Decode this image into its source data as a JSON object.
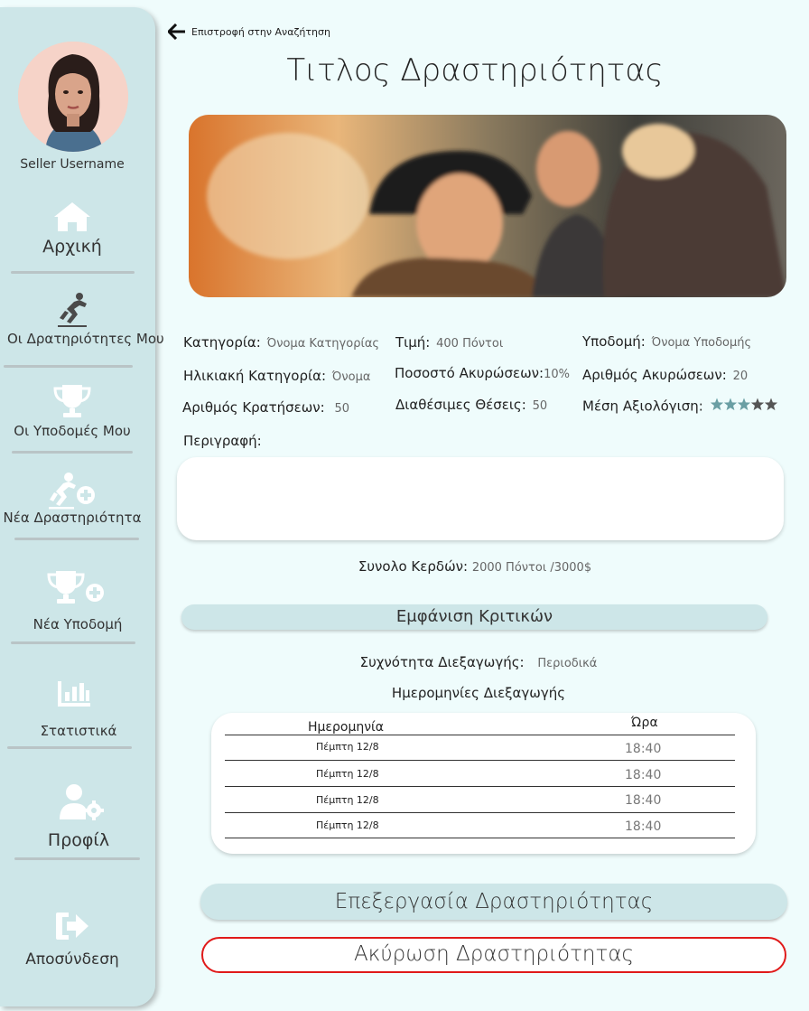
{
  "sidebar": {
    "seller_username": "Seller Username",
    "items": [
      {
        "label": "Αρχική",
        "icon": "home-icon"
      },
      {
        "label": "Οι Δρατηριότητες Μου",
        "icon": "skater-icon"
      },
      {
        "label": "Οι Υποδομές Μου",
        "icon": "trophy-icon"
      },
      {
        "label": "Νέα Δραστηριότητα",
        "icon": "skater-plus-icon"
      },
      {
        "label": "Νέα Υποδομή",
        "icon": "trophy-plus-icon"
      },
      {
        "label": "Στατιστικά",
        "icon": "bar-chart-icon"
      },
      {
        "label": "Προφίλ",
        "icon": "user-gear-icon"
      },
      {
        "label": "Αποσύνδεση",
        "icon": "logout-icon"
      }
    ]
  },
  "back_link": "Επιστροφή στην Αναζήτηση",
  "title": "Τιτλος Δραστηριότητας",
  "info": {
    "category_label": "Κατηγορία:",
    "category_value": "Όνομα Κατηγορίας",
    "price_label": "Τιμή:",
    "price_value": "400 Πόντοι",
    "facility_label": "Υποδομή:",
    "facility_value": "Όνομα Υποδομής",
    "age_label": "Ηλικιακή Κατηγορία:",
    "age_value": "Όνομα",
    "cancel_rate_label": "Ποσοστό Ακυρώσεων:",
    "cancel_rate_value": "10%",
    "cancellations_label": "Αριθμός Ακυρώσεων:",
    "cancellations_value": "20",
    "bookings_label": "Αριθμός Κρατήσεων:",
    "bookings_value": "50",
    "seats_label": "Διαθέσιμες Θέσεις:",
    "seats_value": "50",
    "rating_label": "Μέση Αξιολόγιση:",
    "rating_value": 3,
    "rating_max": 5
  },
  "description_label": "Περιγραφή:",
  "description_value": "",
  "earnings_label": "Συνολο Κερδών:",
  "earnings_value": "2000 Πόντοι /3000$",
  "reviews_button": "Εμφάνιση Κριτικών",
  "frequency_label": "Συχνότητα Διεξαγωγής:",
  "frequency_value": "Περιοδικά",
  "dates_title": "Ημερομηνίες Διεξαγωγής",
  "schedule": {
    "headers": {
      "date": "Ημερομηνία",
      "time": "Ώρα"
    },
    "rows": [
      {
        "date": "Πέμπτη 12/8",
        "time": "18:40"
      },
      {
        "date": "Πέμπτη 12/8",
        "time": "18:40"
      },
      {
        "date": "Πέμπτη 12/8",
        "time": "18:40"
      },
      {
        "date": "Πέμπτη 12/8",
        "time": "18:40"
      }
    ]
  },
  "edit_button": "Επεξεργασία Δραστηριότητας",
  "cancel_button": "Ακύρωση Δραστηριότητας",
  "colors": {
    "background": "#effcfc",
    "sidebar": "#cde6e8",
    "star_filled": "#6a9fa4",
    "star_empty": "#555555",
    "cancel_border": "#e01a1a"
  }
}
